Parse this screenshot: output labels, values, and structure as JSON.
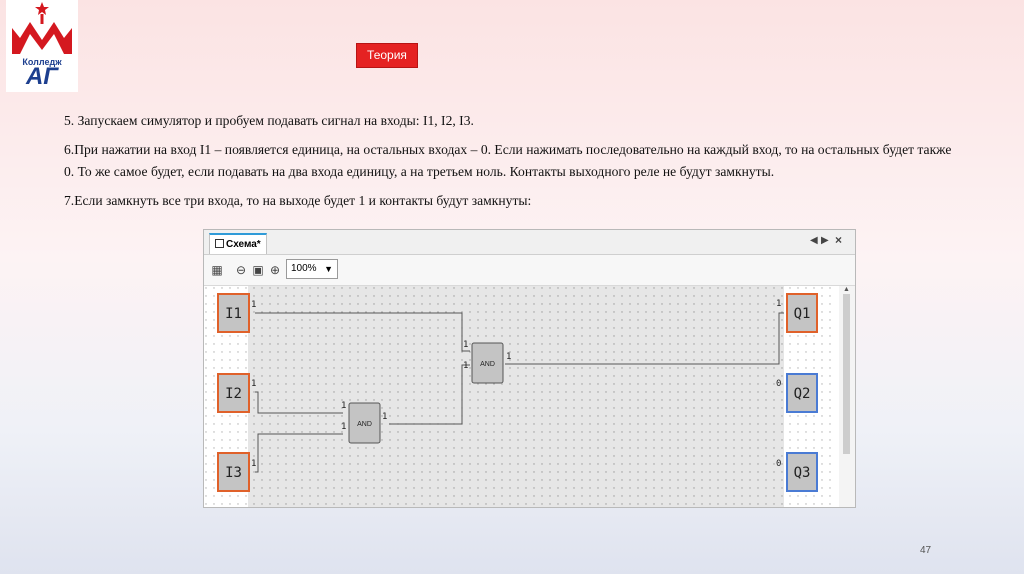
{
  "logo": {
    "college_label": "Колледж",
    "letters": "АГ"
  },
  "theory_badge": "Теория",
  "paragraphs": [
    "5. Запускаем симулятор и пробуем подавать сигнал на входы: I1, I2, I3.",
    "6.При нажатии на вход I1 – появляется единица, на остальных входах – 0. Если нажимать последовательно на каждый вход, то на остальных будет также 0. То же самое будет, если подавать на два входа единицу, а на третьем ноль. Контакты выходного реле не будут замкнуты.",
    "7.Если замкнуть все три входа, то на выходе будет 1 и контакты будут замкнуты:"
  ],
  "page_number": "47",
  "window": {
    "tab_label": "Схема*",
    "zoom": "100%",
    "colors": {
      "input_border": "#e0612a",
      "output_on_border": "#e0612a",
      "output_off_border": "#4a7bd4",
      "block_fill": "#c4c4c4",
      "canvas_bg": "#e6e6e6"
    },
    "inputs": [
      {
        "label": "I1",
        "signal": "1"
      },
      {
        "label": "I2",
        "signal": "1"
      },
      {
        "label": "I3",
        "signal": "1"
      }
    ],
    "outputs": [
      {
        "label": "Q1",
        "signal": "1",
        "state": "on"
      },
      {
        "label": "Q2",
        "signal": "0",
        "state": "off"
      },
      {
        "label": "Q3",
        "signal": "0",
        "state": "off"
      }
    ],
    "gates": [
      {
        "label": "AND",
        "in1": "1",
        "in2": "1",
        "out": "1"
      },
      {
        "label": "AND",
        "in1": "1",
        "in2": "1",
        "out": "1"
      }
    ]
  }
}
